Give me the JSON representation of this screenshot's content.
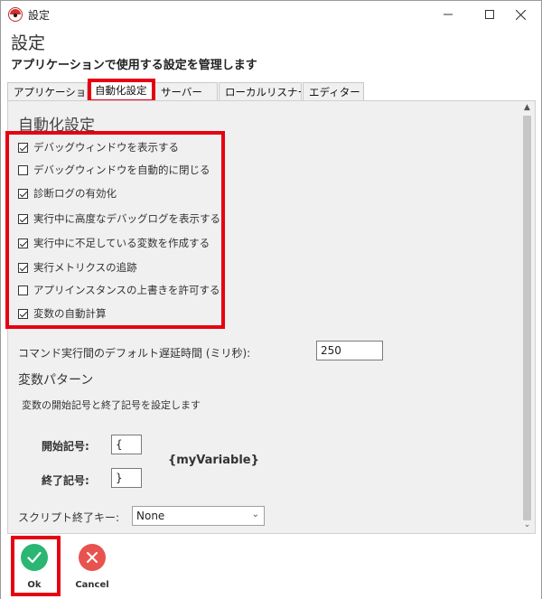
{
  "window": {
    "title": "設定",
    "app_icon": "app-logo-icon",
    "controls": [
      "minimize-icon",
      "maximize-icon",
      "close-icon"
    ]
  },
  "header": {
    "title": "設定",
    "subtitle": "アプリケーションで使用する設定を管理します"
  },
  "tabs": [
    {
      "label": "アプリケーション",
      "active": false
    },
    {
      "label": "自動化設定",
      "active": true
    },
    {
      "label": "サーバー",
      "active": false
    },
    {
      "label": "ローカルリスナー",
      "active": false
    },
    {
      "label": "エディター",
      "active": false
    }
  ],
  "section": {
    "title": "自動化設定",
    "options": [
      {
        "label": "デバッグウィンドウを表示する",
        "checked": true
      },
      {
        "label": "デバッグウィンドウを自動的に閉じる",
        "checked": false
      },
      {
        "label": "診断ログの有効化",
        "checked": true
      },
      {
        "label": "実行中に高度なデバッグログを表示する",
        "checked": true
      },
      {
        "label": "実行中に不足している変数を作成する",
        "checked": true
      },
      {
        "label": "実行メトリクスの追跡",
        "checked": true
      },
      {
        "label": "アプリインスタンスの上書きを許可する",
        "checked": false
      },
      {
        "label": "変数の自動計算",
        "checked": true
      }
    ]
  },
  "delay": {
    "label": "コマンド実行間のデフォルト遅延時間 (ミリ秒):",
    "value": "250"
  },
  "variable_pattern": {
    "title": "変数パターン",
    "description": "変数の開始記号と終了記号を設定します",
    "start_label": "開始記号:",
    "start_value": "{",
    "end_label": "終了記号:",
    "end_value": "}",
    "example": "{myVariable}"
  },
  "script_end_key": {
    "label": "スクリプト終了キー:",
    "value": "None"
  },
  "footer": {
    "ok_label": "Ok",
    "cancel_label": "Cancel"
  },
  "colors": {
    "highlight": "#e60012",
    "ok": "#2bb673",
    "cancel": "#e8534f"
  }
}
